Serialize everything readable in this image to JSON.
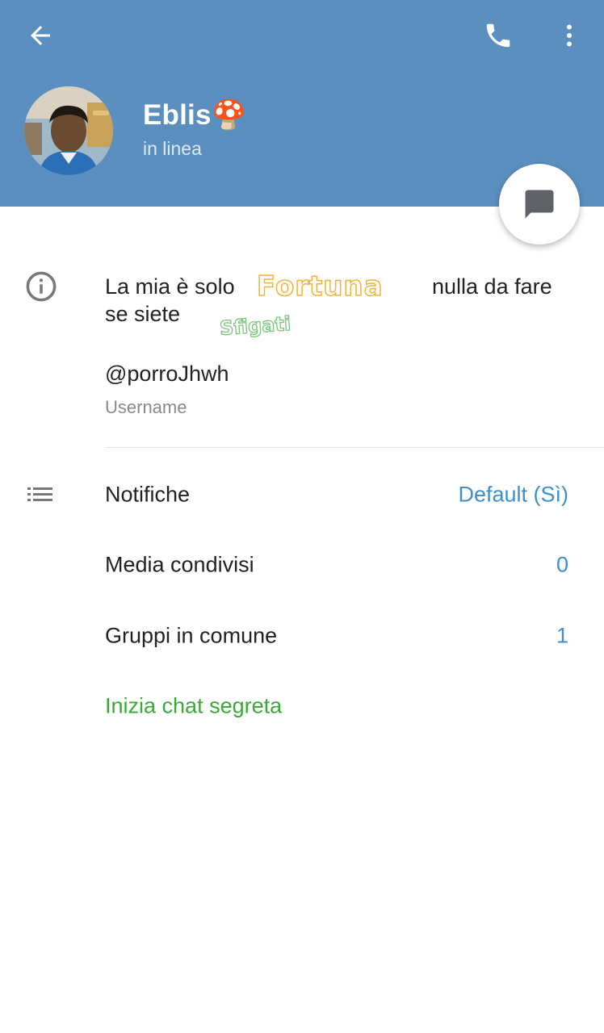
{
  "header": {
    "name": "Eblis🍄",
    "status": "in linea",
    "back_icon": "arrow-left-icon",
    "call_icon": "phone-icon",
    "menu_icon": "more-vert-icon",
    "color": "#5b8fbf"
  },
  "fab": {
    "icon": "message-icon"
  },
  "bio": {
    "line1_start": "La mia è solo",
    "line1_end": "nulla da fare",
    "line2": "se siete",
    "sticker_1": "Fortuna",
    "sticker_2": "Sfigati"
  },
  "username": {
    "value": "@porroJhwh",
    "label": "Username"
  },
  "rows": [
    {
      "label": "Notifiche",
      "value": "Default (Sì)"
    },
    {
      "label": "Media condivisi",
      "value": "0"
    },
    {
      "label": "Gruppi in comune",
      "value": "1"
    },
    {
      "label": "Inizia chat segreta",
      "value": ""
    }
  ],
  "colors": {
    "accent": "#3f8fcb",
    "secret": "#3aaa35"
  }
}
